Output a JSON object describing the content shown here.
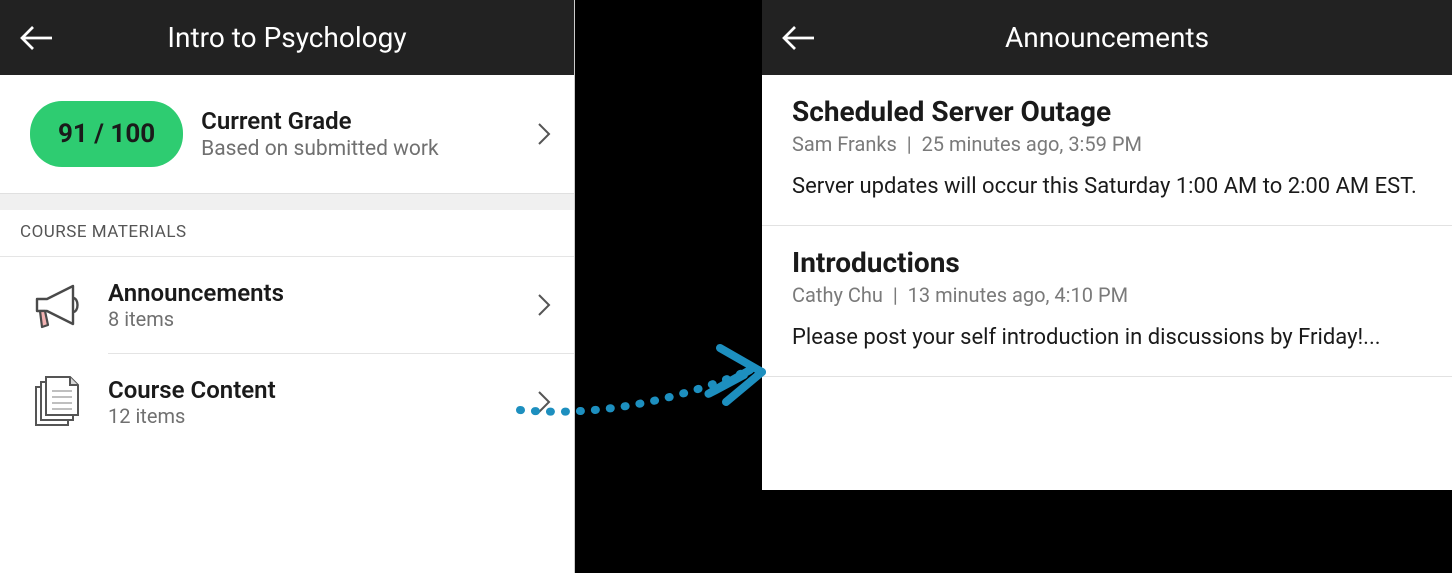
{
  "left": {
    "header_title": "Intro to Psychology",
    "grade": {
      "score": "91 / 100",
      "title": "Current Grade",
      "subtitle": "Based on submitted work"
    },
    "section_header": "COURSE MATERIALS",
    "materials": [
      {
        "title": "Announcements",
        "subtitle": "8 items"
      },
      {
        "title": "Course Content",
        "subtitle": "12 items"
      }
    ]
  },
  "right": {
    "header_title": "Announcements",
    "announcements": [
      {
        "title": "Scheduled Server Outage",
        "author": "Sam Franks",
        "time": "25 minutes ago, 3:59 PM",
        "body": "Server updates will occur this Saturday 1:00 AM to 2:00 AM EST."
      },
      {
        "title": "Introductions",
        "author": "Cathy Chu",
        "time": "13 minutes ago, 4:10 PM",
        "body": "Please post your self introduction in discussions by Friday!..."
      }
    ]
  }
}
